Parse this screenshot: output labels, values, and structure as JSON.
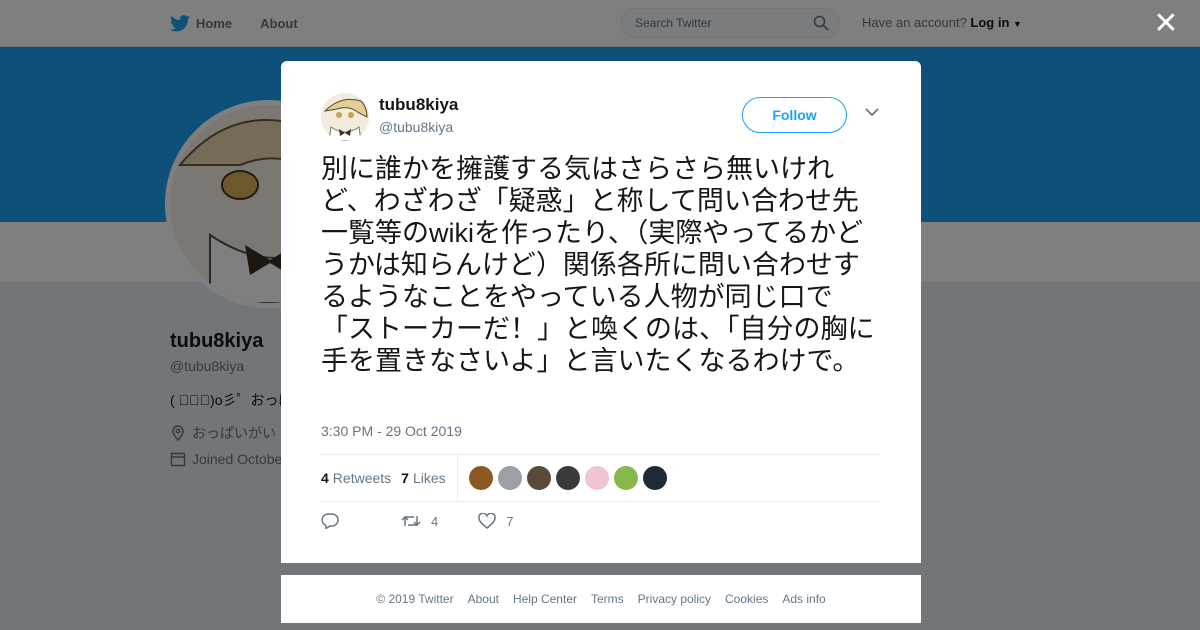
{
  "nav": {
    "home": "Home",
    "about": "About",
    "search_placeholder": "Search Twitter",
    "account_prompt": "Have an account?",
    "login": "Log in"
  },
  "profile": {
    "name": "tubu8kiya",
    "handle": "@tubu8kiya",
    "bio": "( ﾟ∀ﾟ)o彡゜おっぱ",
    "location": "おっぱいがい",
    "joined": "Joined Octobe"
  },
  "tweet": {
    "name": "tubu8kiya",
    "handle": "@tubu8kiya",
    "follow_label": "Follow",
    "text": "別に誰かを擁護する気はさらさら無いけれど、わざわざ「疑惑」と称して問い合わせ先一覧等のwikiを作ったり、（実際やってるかどうかは知らんけど）関係各所に問い合わせするようなことをやっている人物が同じ口で「ストーカーだ！」と喚くのは、「自分の胸に手を置きなさいよ」と言いたくなるわけで。",
    "timestamp": "3:30 PM - 29 Oct 2019",
    "retweets_count": "4",
    "retweets_label": "Retweets",
    "likes_count": "7",
    "likes_label": "Likes",
    "action_retweet_count": "4",
    "action_like_count": "7",
    "liker_colors": [
      "#8a5a1e",
      "#9aa0a6",
      "#5b4a3a",
      "#3a3a3a",
      "#f0c4d4",
      "#86b84a",
      "#1f2a36"
    ]
  },
  "footer": {
    "copyright": "© 2019 Twitter",
    "about": "About",
    "help": "Help Center",
    "terms": "Terms",
    "privacy": "Privacy policy",
    "cookies": "Cookies",
    "ads": "Ads info"
  },
  "colors": {
    "accent": "#1da1f2",
    "overlay": "rgba(0,0,0,0.5)"
  }
}
